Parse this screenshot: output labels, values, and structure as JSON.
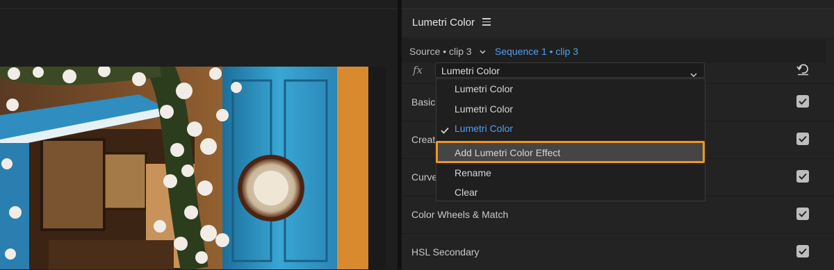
{
  "panel": {
    "title": "Lumetri Color",
    "menu_icon": "hamburger-menu-icon"
  },
  "source": {
    "label": "Source • clip 3",
    "sequence": "Sequence 1 • clip 3"
  },
  "effect": {
    "fx_icon": "fx",
    "selected": "Lumetri Color"
  },
  "dropdown": {
    "items": [
      {
        "label": "Lumetri Color",
        "checked": false
      },
      {
        "label": "Lumetri Color",
        "checked": false
      },
      {
        "label": "Lumetri Color",
        "checked": true
      },
      {
        "label": "Add Lumetri Color Effect",
        "highlighted": true
      },
      {
        "label": "Rename"
      },
      {
        "label": "Clear"
      }
    ]
  },
  "sections": [
    {
      "label": "Basic",
      "enabled": true
    },
    {
      "label": "Creat",
      "enabled": true
    },
    {
      "label": "Curve",
      "enabled": true
    },
    {
      "label": "Color Wheels & Match",
      "enabled": true
    },
    {
      "label": "HSL Secondary",
      "enabled": true
    }
  ],
  "colors": {
    "accent_blue": "#4ea0f0",
    "highlight_orange": "#f2961e",
    "panel_bg": "#232323"
  }
}
